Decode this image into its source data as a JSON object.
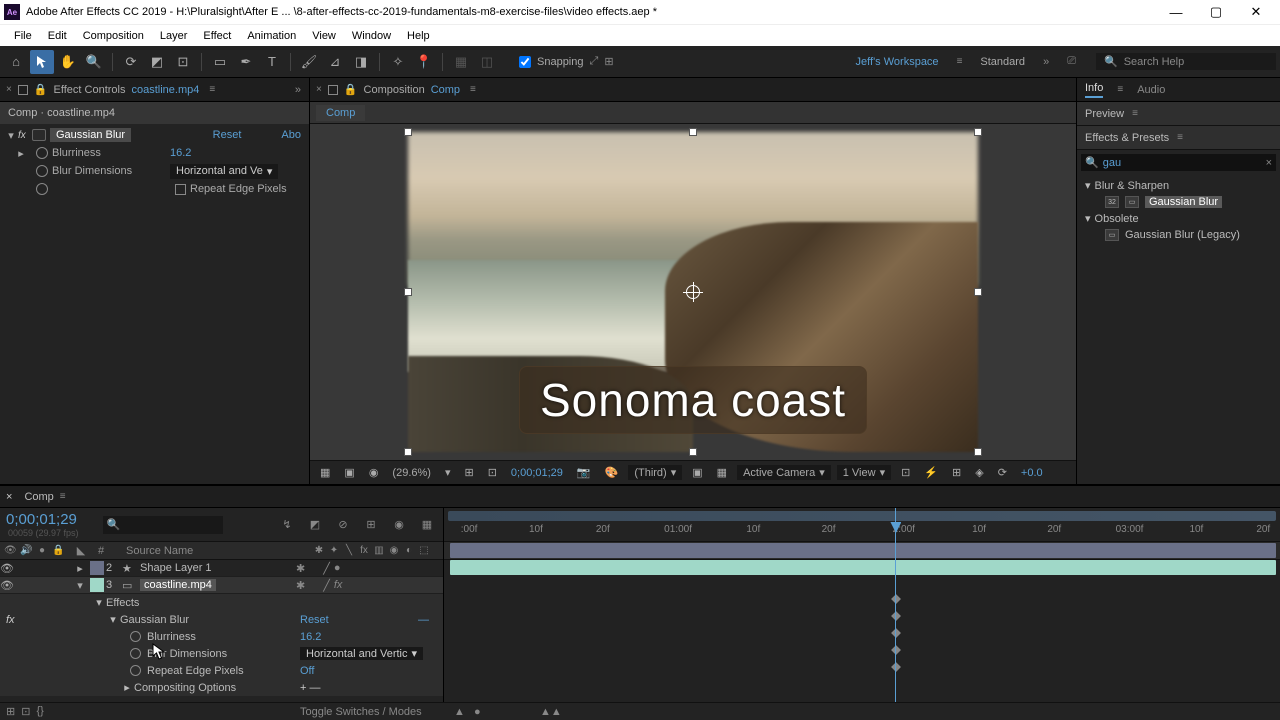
{
  "window": {
    "app_name": "Adobe After Effects CC 2019",
    "file_path": "H:\\Pluralsight\\After E ... \\8-after-effects-cc-2019-fundamentals-m8-exercise-files\\video effects.aep *"
  },
  "menu": [
    "File",
    "Edit",
    "Composition",
    "Layer",
    "Effect",
    "Animation",
    "View",
    "Window",
    "Help"
  ],
  "toolbar": {
    "snapping_label": "Snapping",
    "workspace_label": "Jeff's Workspace",
    "layout_label": "Standard",
    "search_placeholder": "Search Help"
  },
  "effect_controls": {
    "panel_label": "Effect Controls",
    "source": "coastline.mp4",
    "breadcrumb": "Comp · coastline.mp4",
    "effect_name": "Gaussian Blur",
    "reset": "Reset",
    "about": "Abo",
    "blurriness_label": "Blurriness",
    "blurriness_value": "16.2",
    "blur_dims_label": "Blur Dimensions",
    "blur_dims_value": "Horizontal and Ve",
    "repeat_edge_label": "Repeat Edge Pixels"
  },
  "composition": {
    "panel_label": "Composition",
    "comp_name": "Comp",
    "tab_name": "Comp",
    "caption_text": "Sonoma coast",
    "zoom": "(29.6%)",
    "timecode": "0;00;01;29",
    "quality": "(Third)",
    "camera": "Active Camera",
    "views": "1 View",
    "exposure": "+0.0"
  },
  "right_panel": {
    "info_tab": "Info",
    "audio_tab": "Audio",
    "preview_header": "Preview",
    "ep_header": "Effects & Presets",
    "search_value": "gau",
    "cat1": "Blur & Sharpen",
    "item1": "Gaussian Blur",
    "cat2": "Obsolete",
    "item2": "Gaussian Blur (Legacy)"
  },
  "timeline": {
    "tab_name": "Comp",
    "current_time": "0;00;01;29",
    "frame_info": "00059 (29.97 fps)",
    "col_num": "#",
    "col_source": "Source Name",
    "layers": [
      {
        "index": "2",
        "name": "Shape Layer 1",
        "color": "#6a7088"
      },
      {
        "index": "3",
        "name": "coastline.mp4",
        "color": "#a0d8c8"
      }
    ],
    "effects_label": "Effects",
    "gauss_label": "Gaussian Blur",
    "gauss_reset": "Reset",
    "blurriness_label": "Blurriness",
    "blurriness_value": "16.2",
    "blur_dims_label": "Blur Dimensions",
    "blur_dims_value": "Horizontal and Vertic",
    "repeat_label": "Repeat Edge Pixels",
    "repeat_value": "Off",
    "comp_options": "Compositing Options",
    "toggle_label": "Toggle Switches / Modes",
    "ruler_ticks": [
      ":00f",
      "10f",
      "20f",
      "01:00f",
      "10f",
      "20f",
      "2:00f",
      "10f",
      "20f",
      "03:00f",
      "10f",
      "20f"
    ]
  }
}
